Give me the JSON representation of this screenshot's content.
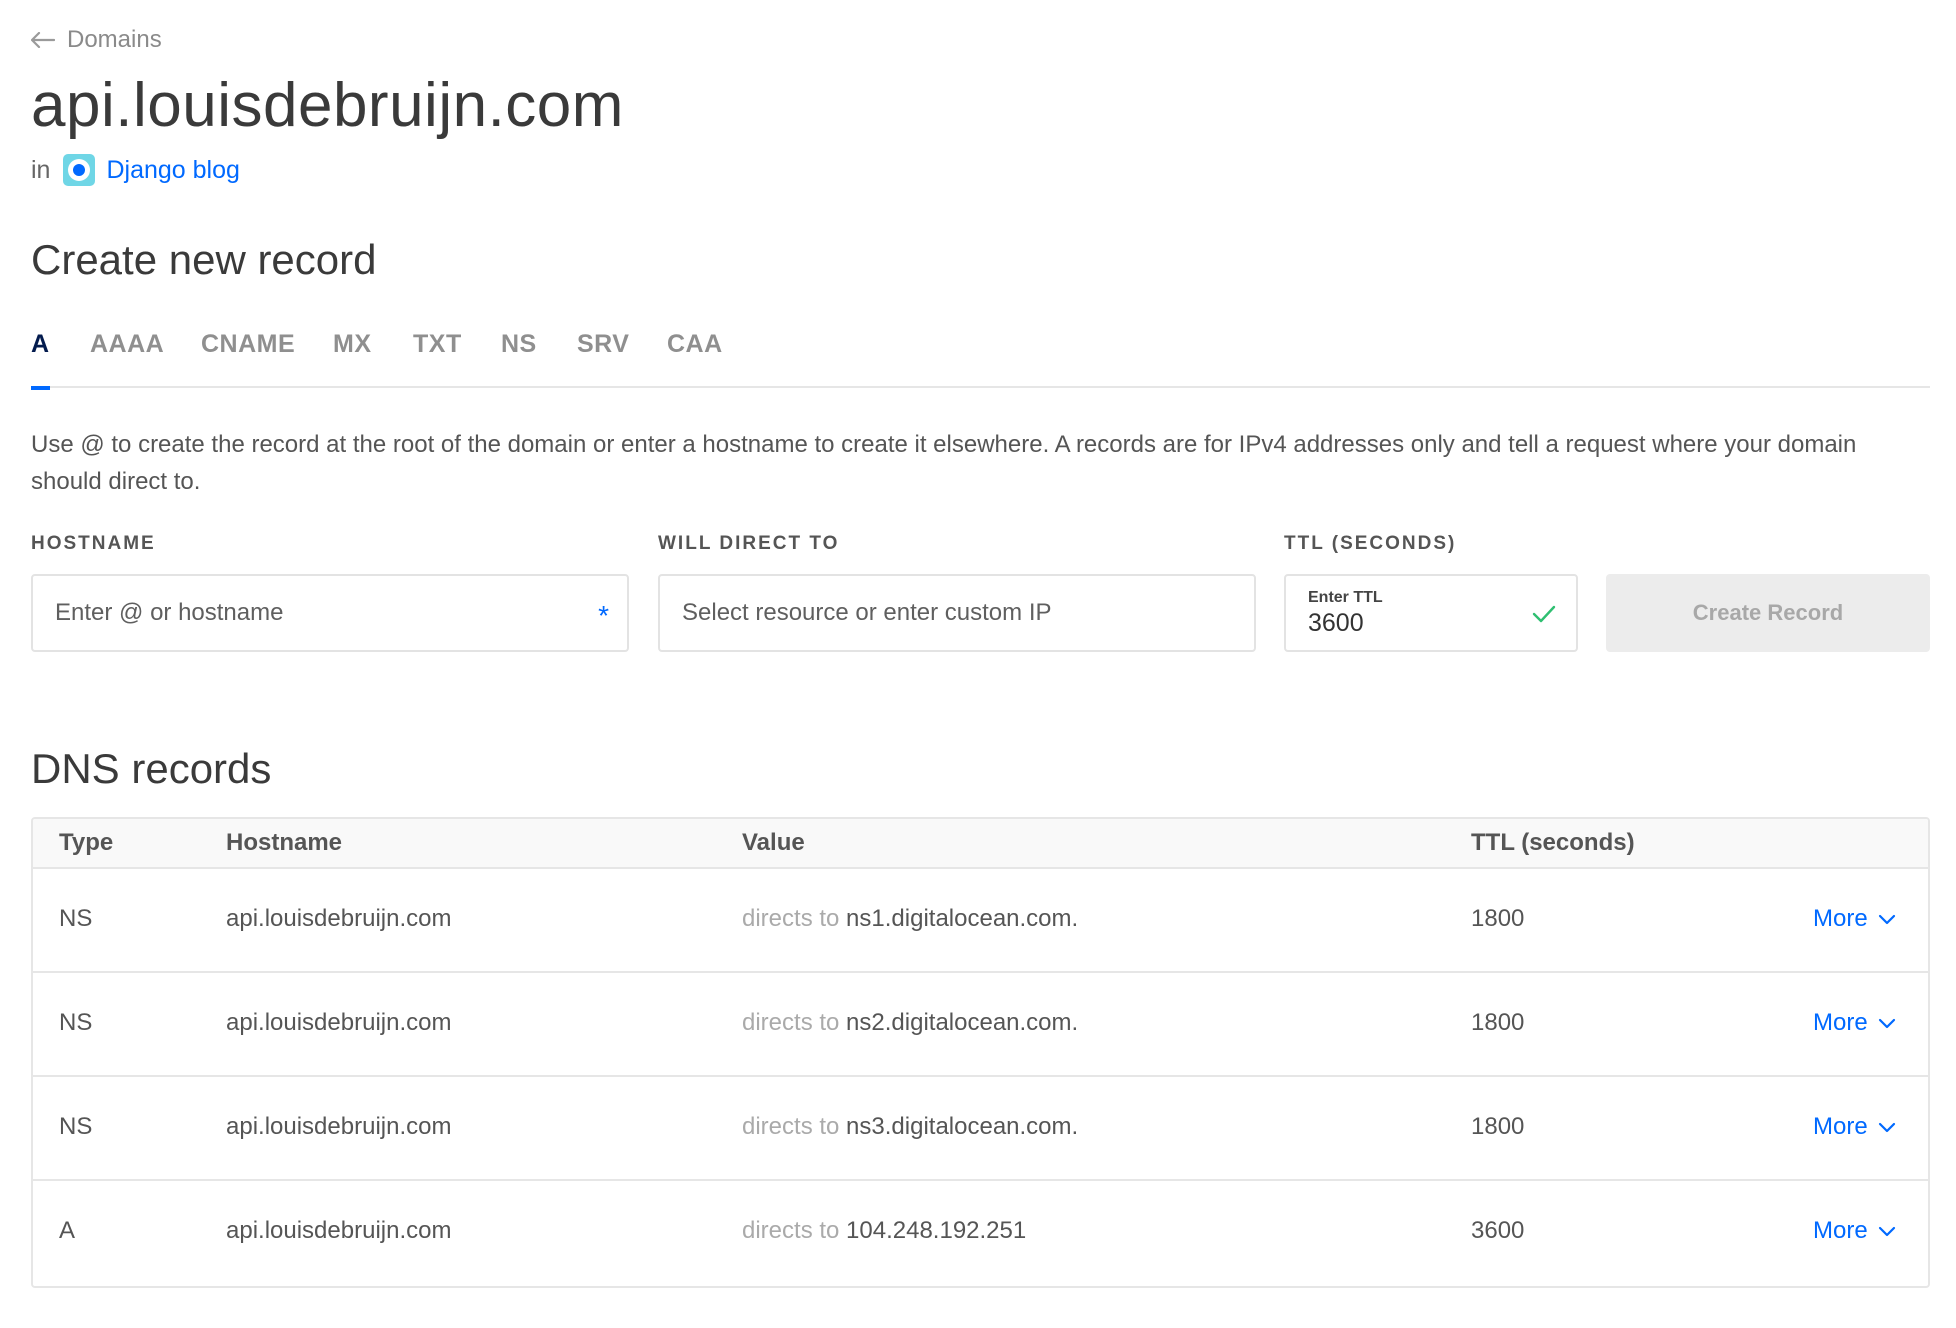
{
  "breadcrumb": {
    "back_label": "Domains",
    "icon": "arrow-left-icon"
  },
  "page": {
    "title": "api.louisdebruijn.com",
    "in_label": "in",
    "project_name": "Django blog",
    "project_icon_color": "#6fd6e6"
  },
  "create_record": {
    "title": "Create new record",
    "tabs": [
      {
        "label": "A",
        "active": true
      },
      {
        "label": "AAAA",
        "active": false
      },
      {
        "label": "CNAME",
        "active": false
      },
      {
        "label": "MX",
        "active": false
      },
      {
        "label": "TXT",
        "active": false
      },
      {
        "label": "NS",
        "active": false
      },
      {
        "label": "SRV",
        "active": false
      },
      {
        "label": "CAA",
        "active": false
      }
    ],
    "help_text": "Use @ to create the record at the root of the domain or enter a hostname to create it elsewhere. A records are for IPv4 addresses only and tell a request where your domain should direct to.",
    "hostname": {
      "label": "HOSTNAME",
      "placeholder": "Enter @ or hostname",
      "required_mark": "*"
    },
    "direct_to": {
      "label": "WILL DIRECT TO",
      "placeholder": "Select resource or enter custom IP"
    },
    "ttl": {
      "label": "TTL (SECONDS)",
      "inner_label": "Enter TTL",
      "value": "3600",
      "valid": true
    },
    "submit_label": "Create Record"
  },
  "dns_records": {
    "title": "DNS records",
    "columns": [
      "Type",
      "Hostname",
      "Value",
      "TTL (seconds)"
    ],
    "directs_prefix": "directs to",
    "more_label": "More",
    "rows": [
      {
        "type": "NS",
        "hostname": "api.louisdebruijn.com",
        "value": "ns1.digitalocean.com.",
        "ttl": "1800"
      },
      {
        "type": "NS",
        "hostname": "api.louisdebruijn.com",
        "value": "ns2.digitalocean.com.",
        "ttl": "1800"
      },
      {
        "type": "NS",
        "hostname": "api.louisdebruijn.com",
        "value": "ns3.digitalocean.com.",
        "ttl": "1800"
      },
      {
        "type": "A",
        "hostname": "api.louisdebruijn.com",
        "value": "104.248.192.251",
        "ttl": "3600"
      }
    ]
  },
  "colors": {
    "accent": "#0069ff",
    "active_tab_text": "#031b4e",
    "valid_check": "#2fbf71",
    "disabled_button_bg": "#ececec"
  }
}
